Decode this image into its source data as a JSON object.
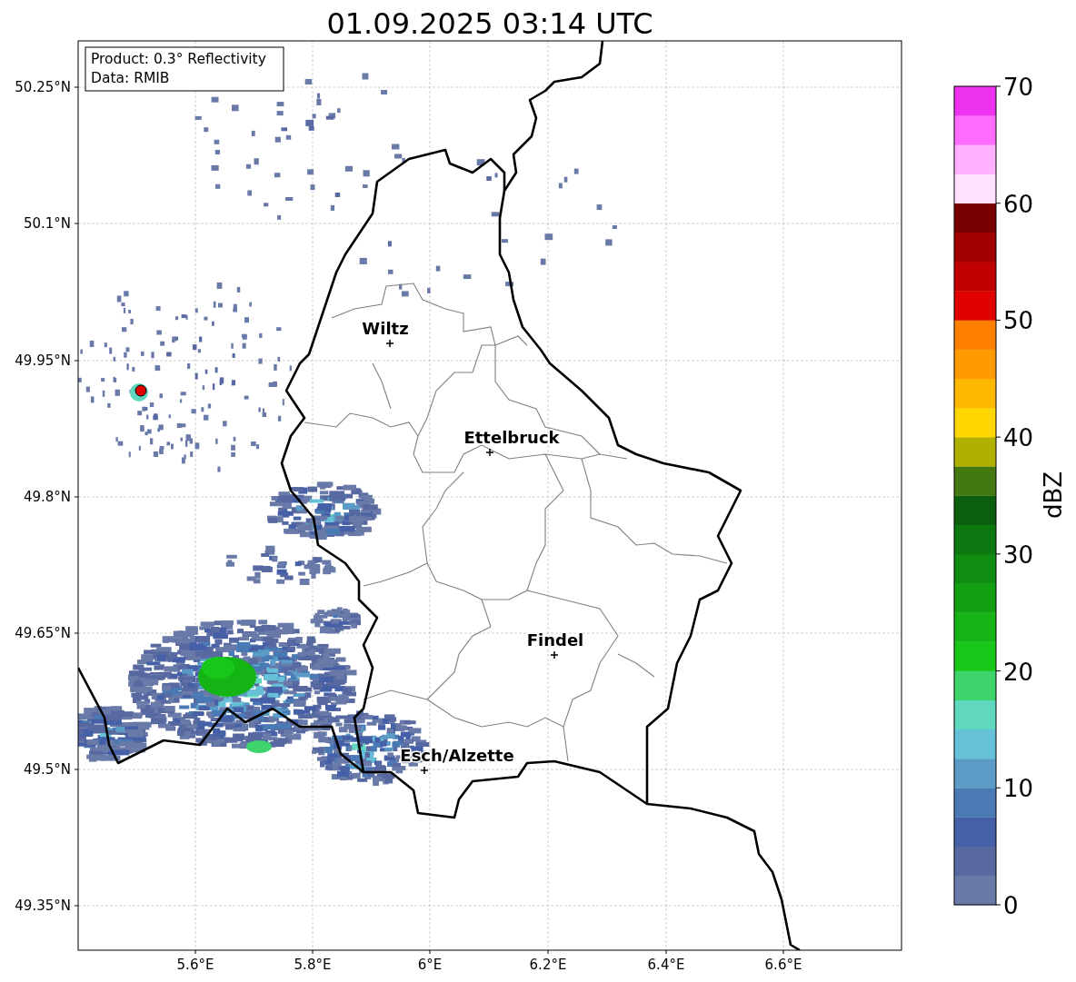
{
  "title": "01.09.2025 03:14 UTC",
  "info_box": [
    "Product: 0.3° Reflectivity",
    "Data: RMIB"
  ],
  "y_ticks": [
    "50.25°N",
    "50.1°N",
    "49.95°N",
    "49.8°N",
    "49.65°N",
    "49.5°N",
    "49.35°N"
  ],
  "x_ticks": [
    "5.6°E",
    "5.8°E",
    "6°E",
    "6.2°E",
    "6.4°E",
    "6.6°E"
  ],
  "cities": [
    {
      "name": "Wiltz"
    },
    {
      "name": "Ettelbruck"
    },
    {
      "name": "Findel"
    },
    {
      "name": "Esch/Alzette"
    }
  ],
  "colorbar": {
    "label": "dBZ",
    "ticks": [
      "70",
      "60",
      "50",
      "40",
      "30",
      "20",
      "10",
      "0"
    ],
    "bands": [
      {
        "color": "#6a7aa8"
      },
      {
        "color": "#5868a0"
      },
      {
        "color": "#4560a6"
      },
      {
        "color": "#4a7ab4"
      },
      {
        "color": "#5a9cc6"
      },
      {
        "color": "#66c0d8"
      },
      {
        "color": "#60d8c0"
      },
      {
        "color": "#3ed46c"
      },
      {
        "color": "#18c818"
      },
      {
        "color": "#14b414"
      },
      {
        "color": "#12a012"
      },
      {
        "color": "#108c10"
      },
      {
        "color": "#0c7810"
      },
      {
        "color": "#0a600e"
      },
      {
        "color": "#447810"
      },
      {
        "color": "#b0b000"
      },
      {
        "color": "#ffd700"
      },
      {
        "color": "#ffb800"
      },
      {
        "color": "#ff9a00"
      },
      {
        "color": "#ff7f00"
      },
      {
        "color": "#e00000"
      },
      {
        "color": "#c00000"
      },
      {
        "color": "#a00000"
      },
      {
        "color": "#780000"
      },
      {
        "color": "#ffe0ff"
      },
      {
        "color": "#ffb0ff"
      },
      {
        "color": "#ff6cff"
      },
      {
        "color": "#ee33ee"
      }
    ]
  }
}
